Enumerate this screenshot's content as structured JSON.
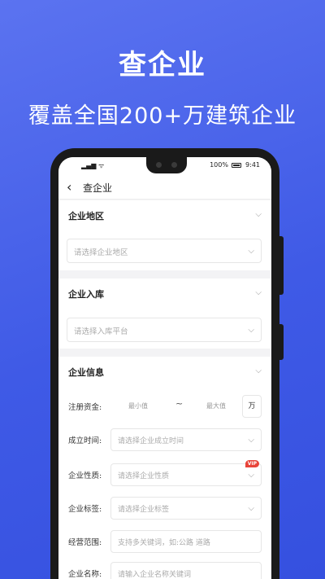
{
  "promo": {
    "title": "查企业",
    "subtitle": "覆盖全国200+万建筑企业"
  },
  "status_bar": {
    "battery_percent": "100%",
    "time": "9:41"
  },
  "nav": {
    "back_icon": "back-chevron-icon",
    "title": "查企业"
  },
  "sections": {
    "region": {
      "label": "企业地区",
      "placeholder": "请选择企业地区"
    },
    "entry": {
      "label": "企业入库",
      "placeholder": "请选择入库平台"
    },
    "info": {
      "label": "企业信息",
      "capital": {
        "label": "注册资金:",
        "min_placeholder": "最小值",
        "separator": "~",
        "max_placeholder": "最大值",
        "unit": "万"
      },
      "founded": {
        "label": "成立时间:",
        "placeholder": "请选择企业成立时间"
      },
      "nature": {
        "label": "企业性质:",
        "placeholder": "请选择企业性质",
        "badge": "VIP"
      },
      "tags": {
        "label": "企业标签:",
        "placeholder": "请选择企业标签"
      },
      "scope": {
        "label": "经营范围:",
        "placeholder": "支持多关键词，如:公路 道路"
      },
      "name": {
        "label": "企业名称:",
        "placeholder": "请输入企业名称关键词"
      }
    }
  },
  "colors": {
    "background": "#4a63ea",
    "vip_badge": "#e8443a"
  }
}
